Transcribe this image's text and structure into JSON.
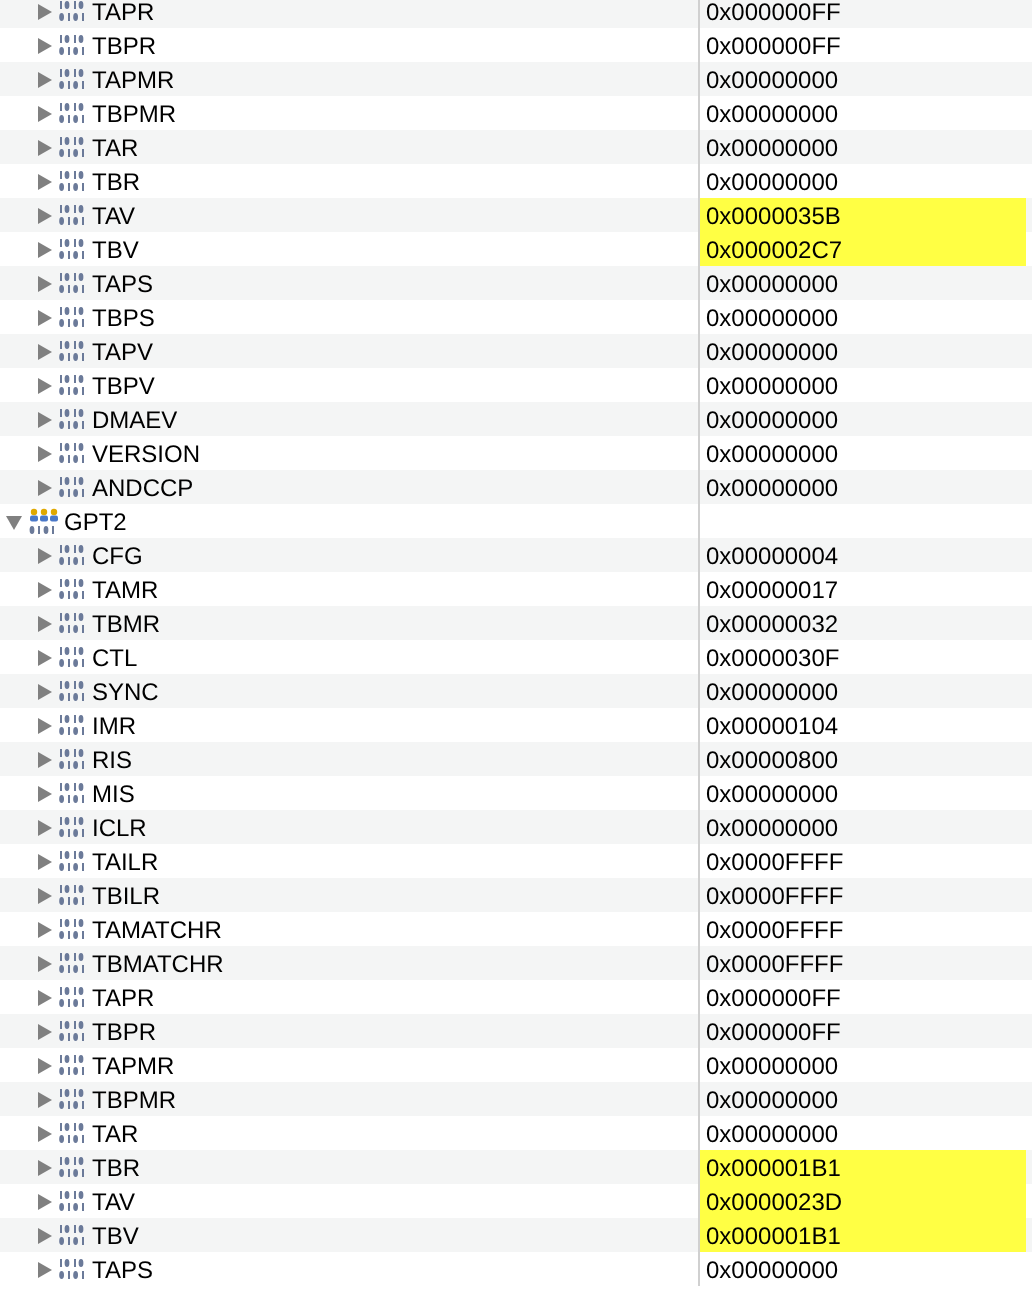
{
  "registers": [
    {
      "name": "TAPR",
      "value": "0x000000FF",
      "changed": false,
      "expanded": false
    },
    {
      "name": "TBPR",
      "value": "0x000000FF",
      "changed": false,
      "expanded": false
    },
    {
      "name": "TAPMR",
      "value": "0x00000000",
      "changed": false,
      "expanded": false
    },
    {
      "name": "TBPMR",
      "value": "0x00000000",
      "changed": false,
      "expanded": false
    },
    {
      "name": "TAR",
      "value": "0x00000000",
      "changed": false,
      "expanded": false
    },
    {
      "name": "TBR",
      "value": "0x00000000",
      "changed": false,
      "expanded": false
    },
    {
      "name": "TAV",
      "value": "0x0000035B",
      "changed": true,
      "expanded": false
    },
    {
      "name": "TBV",
      "value": "0x000002C7",
      "changed": true,
      "expanded": false
    },
    {
      "name": "TAPS",
      "value": "0x00000000",
      "changed": false,
      "expanded": false
    },
    {
      "name": "TBPS",
      "value": "0x00000000",
      "changed": false,
      "expanded": false
    },
    {
      "name": "TAPV",
      "value": "0x00000000",
      "changed": false,
      "expanded": false
    },
    {
      "name": "TBPV",
      "value": "0x00000000",
      "changed": false,
      "expanded": false
    },
    {
      "name": "DMAEV",
      "value": "0x00000000",
      "changed": false,
      "expanded": false
    },
    {
      "name": "VERSION",
      "value": "0x00000000",
      "changed": false,
      "expanded": false
    },
    {
      "name": "ANDCCP",
      "value": "0x00000000",
      "changed": false,
      "expanded": false
    }
  ],
  "peripherals": [
    {
      "name": "GPT2",
      "expanded": true,
      "children": [
        {
          "name": "CFG",
          "value": "0x00000004",
          "changed": false,
          "expanded": false
        },
        {
          "name": "TAMR",
          "value": "0x00000017",
          "changed": false,
          "expanded": false
        },
        {
          "name": "TBMR",
          "value": "0x00000032",
          "changed": false,
          "expanded": false
        },
        {
          "name": "CTL",
          "value": "0x0000030F",
          "changed": false,
          "expanded": false
        },
        {
          "name": "SYNC",
          "value": "0x00000000",
          "changed": false,
          "expanded": false
        },
        {
          "name": "IMR",
          "value": "0x00000104",
          "changed": false,
          "expanded": false
        },
        {
          "name": "RIS",
          "value": "0x00000800",
          "changed": false,
          "expanded": false
        },
        {
          "name": "MIS",
          "value": "0x00000000",
          "changed": false,
          "expanded": false
        },
        {
          "name": "ICLR",
          "value": "0x00000000",
          "changed": false,
          "expanded": false
        },
        {
          "name": "TAILR",
          "value": "0x0000FFFF",
          "changed": false,
          "expanded": false
        },
        {
          "name": "TBILR",
          "value": "0x0000FFFF",
          "changed": false,
          "expanded": false
        },
        {
          "name": "TAMATCHR",
          "value": "0x0000FFFF",
          "changed": false,
          "expanded": false
        },
        {
          "name": "TBMATCHR",
          "value": "0x0000FFFF",
          "changed": false,
          "expanded": false
        },
        {
          "name": "TAPR",
          "value": "0x000000FF",
          "changed": false,
          "expanded": false
        },
        {
          "name": "TBPR",
          "value": "0x000000FF",
          "changed": false,
          "expanded": false
        },
        {
          "name": "TAPMR",
          "value": "0x00000000",
          "changed": false,
          "expanded": false
        },
        {
          "name": "TBPMR",
          "value": "0x00000000",
          "changed": false,
          "expanded": false
        },
        {
          "name": "TAR",
          "value": "0x00000000",
          "changed": false,
          "expanded": false
        },
        {
          "name": "TBR",
          "value": "0x000001B1",
          "changed": true,
          "expanded": false
        },
        {
          "name": "TAV",
          "value": "0x0000023D",
          "changed": true,
          "expanded": false
        },
        {
          "name": "TBV",
          "value": "0x000001B1",
          "changed": true,
          "expanded": false
        },
        {
          "name": "TAPS",
          "value": "0x00000000",
          "changed": false,
          "expanded": false
        }
      ]
    }
  ]
}
